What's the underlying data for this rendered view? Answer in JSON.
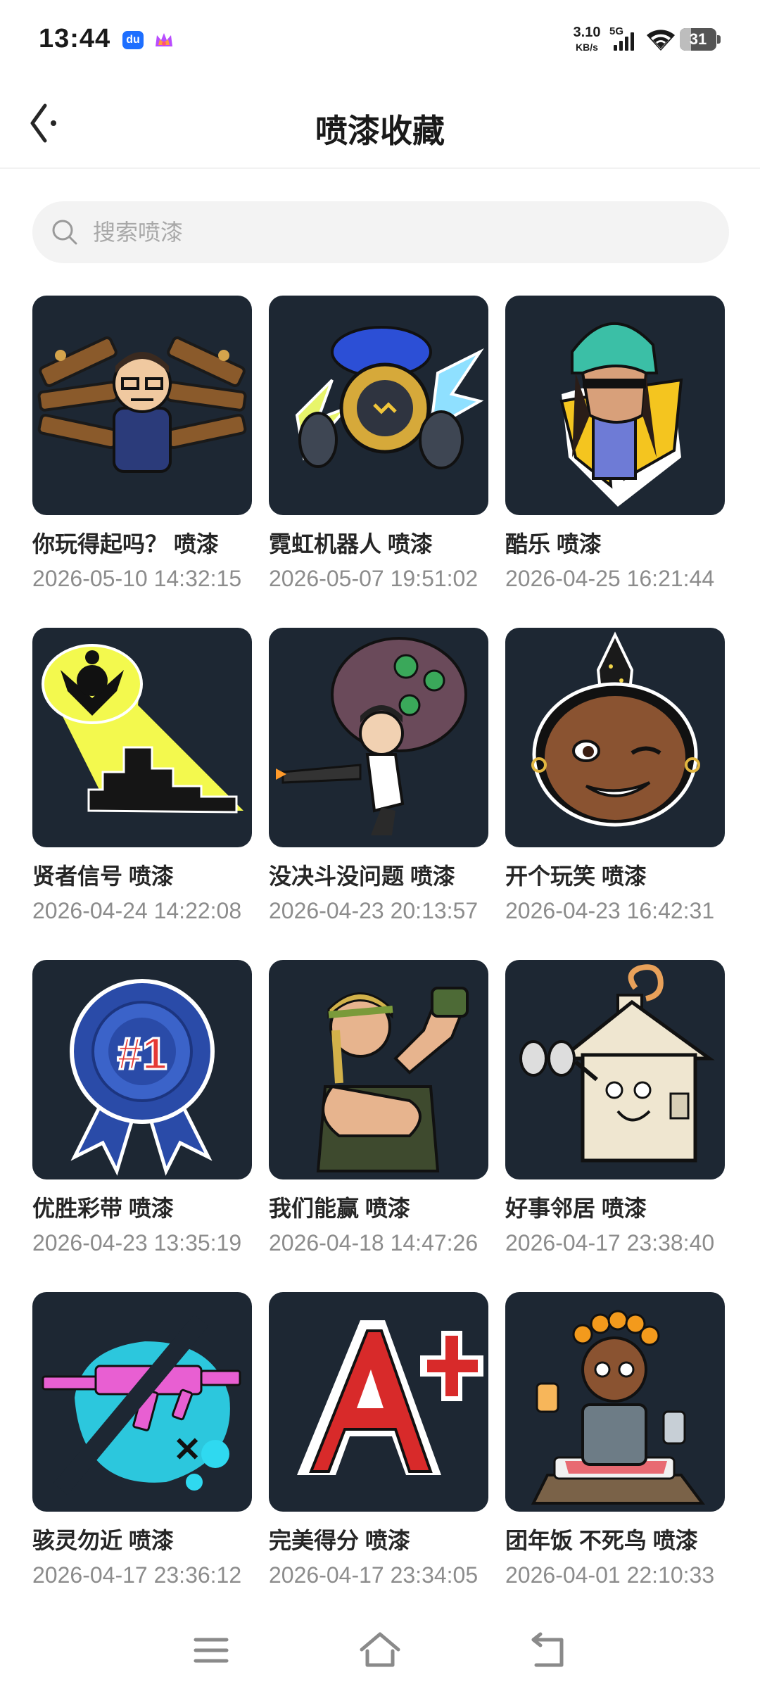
{
  "status_bar": {
    "time": "13:44",
    "app_icon_1": "du-app-icon",
    "app_icon_2": "crown-app-icon",
    "net_speed": "3.10",
    "net_speed_unit": "KB/s",
    "network": "5G",
    "battery": "31",
    "battery_level": 0.31
  },
  "header": {
    "title": "喷漆收藏",
    "back_icon": "back-arrow-icon"
  },
  "search": {
    "placeholder": "搜索喷漆",
    "value": ""
  },
  "sprays": [
    {
      "name": "你玩得起吗？ 喷漆",
      "date": "2026-05-10 14:32:15",
      "art": "guns-man"
    },
    {
      "name": "霓虹机器人 喷漆",
      "date": "2026-05-07 19:51:02",
      "art": "neon-robot"
    },
    {
      "name": "酷乐 喷漆",
      "date": "2026-04-25 16:21:44",
      "art": "cool-girl"
    },
    {
      "name": "贤者信号 喷漆",
      "date": "2026-04-24 14:22:08",
      "art": "sage-signal"
    },
    {
      "name": "没决斗没问题 喷漆",
      "date": "2026-04-23 20:13:57",
      "art": "no-duel"
    },
    {
      "name": "开个玩笑 喷漆",
      "date": "2026-04-23 16:42:31",
      "art": "wink-face"
    },
    {
      "name": "优胜彩带 喷漆",
      "date": "2026-04-23 13:35:19",
      "art": "ribbon"
    },
    {
      "name": "我们能赢 喷漆",
      "date": "2026-04-18 14:47:26",
      "art": "we-can-win"
    },
    {
      "name": "好事邻居 喷漆",
      "date": "2026-04-17 23:38:40",
      "art": "good-neighbor"
    },
    {
      "name": "骇灵勿近 喷漆",
      "date": "2026-04-17 23:36:12",
      "art": "no-ghost"
    },
    {
      "name": "完美得分 喷漆",
      "date": "2026-04-17 23:34:05",
      "art": "a-plus"
    },
    {
      "name": "团年饭 不死鸟 喷漆",
      "date": "2026-04-01 22:10:33",
      "art": "reunion-dinner"
    }
  ],
  "nav_bar": {
    "menu_icon": "menu-icon",
    "home_icon": "home-icon",
    "back_icon": "back-icon"
  }
}
